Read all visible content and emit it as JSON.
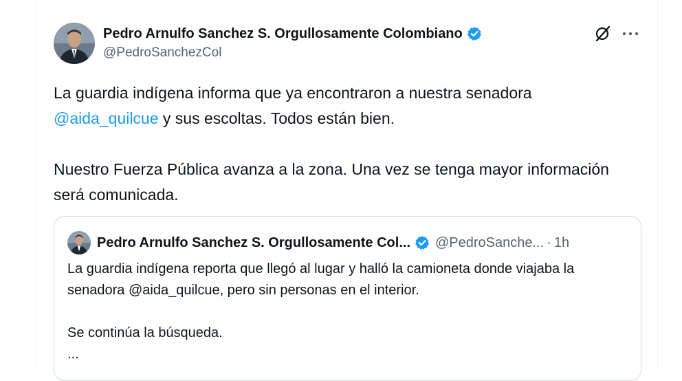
{
  "author": {
    "name": "Pedro Arnulfo Sanchez S. Orgullosamente Colombiano",
    "handle": "@PedroSanchezCol"
  },
  "tweet": {
    "line1_text": "La guardia indígena informa que ya encontraron a nuestra senadora",
    "mention": "@aida_quilcue",
    "line2_text": " y sus escoltas. Todos están bien.",
    "paragraph2": "Nuestro Fuerza Pública avanza a la zona. Una vez se tenga mayor información será comunicada."
  },
  "quoted_tweet": {
    "name": "Pedro Arnulfo Sanchez S. Orgullosamente Col...",
    "handle": "@PedroSanche...",
    "separator": "·",
    "time": "1h",
    "paragraph1": "La guardia indígena reporta que llegó al lugar y halló la camioneta donde viajaba la senadora @aida_quilcue, pero sin personas en el interior.",
    "paragraph2": "Se continúa la búsqueda.",
    "ellipsis": "..."
  },
  "icons": {
    "verified": "verified-badge-icon",
    "grok": "grok-icon",
    "more": "more-options-icon"
  },
  "colors": {
    "verified": "#1d9bf0",
    "mention": "#1d9bf0",
    "secondary_text": "#536471",
    "border": "#cfd9de"
  }
}
